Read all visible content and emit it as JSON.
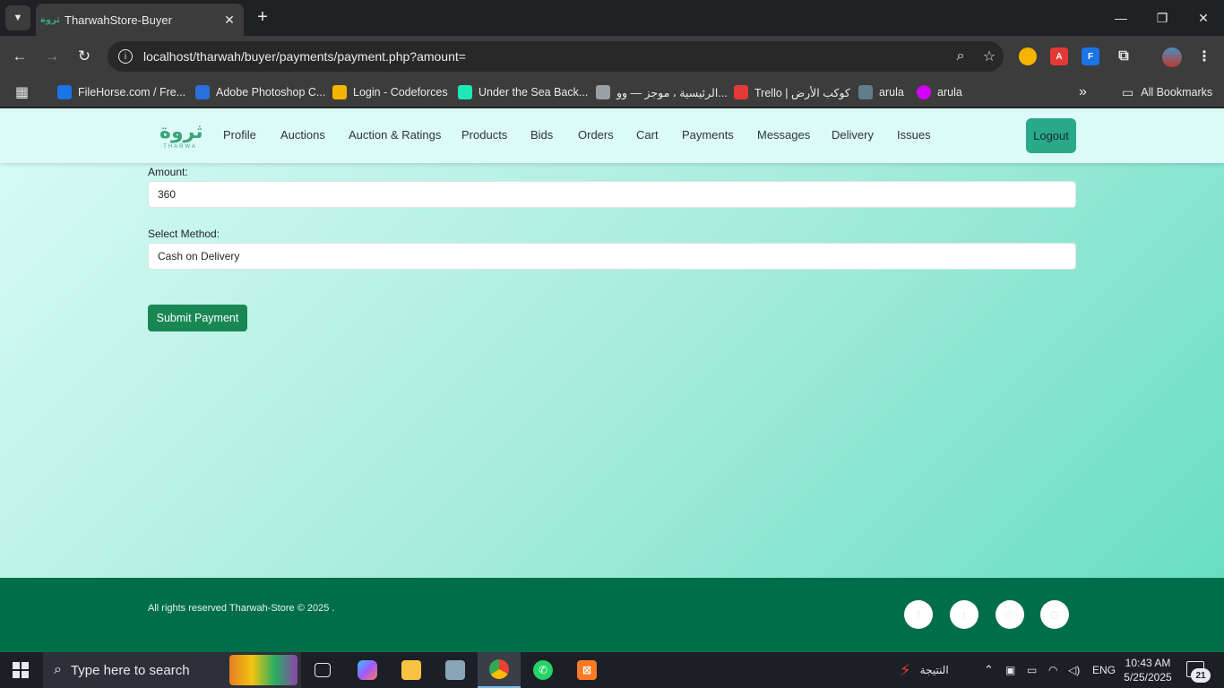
{
  "browser": {
    "tab_title": "TharwahStore-Buyer",
    "tab_favicon": "ثروة",
    "new_tab": "+",
    "url": "localhost/tharwah/buyer/payments/payment.php?amount=",
    "bookmarks": [
      {
        "label": "FileHorse.com / Fre...",
        "color": "#1a73e8"
      },
      {
        "label": "Adobe Photoshop C...",
        "color": "#2a6fdb"
      },
      {
        "label": "Login - Codeforces",
        "color": "#f4b400"
      },
      {
        "label": "Under the Sea Back...",
        "color": "#1de9b6"
      },
      {
        "label": "الرئيسية ، موجز — وو...",
        "color": "#9aa0a6"
      },
      {
        "label": "Trello | كوكب الأرض",
        "color": "#e53935"
      },
      {
        "label": "arula",
        "color": "#607d8b"
      },
      {
        "label": "arula",
        "color": "#d500f9"
      }
    ],
    "bookmarks_overflow": "»",
    "all_bookmarks": "All Bookmarks"
  },
  "site": {
    "logo_ar": "ثروة",
    "logo_en": "THARWA",
    "nav": [
      "Profile",
      "Auctions",
      "Auction & Ratings",
      "Products",
      "Bids",
      "Orders",
      "Cart",
      "Payments",
      "Messages",
      "Delivery",
      "Issues"
    ],
    "logout": "Logout"
  },
  "form": {
    "amount_label": "Amount:",
    "amount_value": "360",
    "method_label": "Select Method:",
    "method_value": "Cash on Delivery",
    "submit": "Submit Payment"
  },
  "footer": {
    "copyright": "All rights reserved Tharwah-Store © 2025 .",
    "social": [
      "facebook-icon",
      "twitter-icon",
      "instagram-icon",
      "google-icon"
    ]
  },
  "taskbar": {
    "search_placeholder": "Type here to search",
    "news": "النتيجة",
    "lang": "ENG",
    "time": "10:43 AM",
    "date": "5/25/2025",
    "notifications": "21"
  }
}
